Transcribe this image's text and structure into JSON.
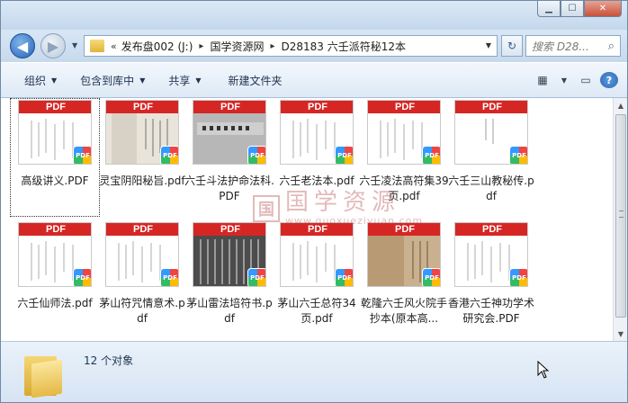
{
  "window": {
    "controls": {
      "minimize": "▁",
      "maximize": "☐",
      "close": "✕"
    }
  },
  "nav": {
    "back_glyph": "◀",
    "forward_glyph": "▶",
    "address": {
      "chevron": "«",
      "crumbs": [
        "发布盘002 (J:)",
        "国学资源网",
        "D28183 六壬派符秘12本"
      ],
      "separator": "▸"
    },
    "refresh_glyph": "↻",
    "search": {
      "placeholder": "搜索 D28...",
      "icon": "search-icon"
    }
  },
  "toolbar": {
    "organize": "组织",
    "include_in_library": "包含到库中",
    "share": "共享",
    "new_folder": "新建文件夹",
    "view_glyph": "▦",
    "pane_glyph": "▭",
    "help_glyph": "?"
  },
  "files": [
    {
      "name": "高级讲义.PDF",
      "thumb": "PDF",
      "art": "lines",
      "selected": true
    },
    {
      "name": "灵宝阴阳秘旨.pdf",
      "thumb": "PDF",
      "art": "scan"
    },
    {
      "name": "六壬斗法护命法科.PDF",
      "thumb": "PDF",
      "art": "gray-title"
    },
    {
      "name": "六壬老法本.pdf",
      "thumb": "PDF",
      "art": "lines"
    },
    {
      "name": "六壬凌法高符集39页.pdf",
      "thumb": "PDF",
      "art": "lines"
    },
    {
      "name": "六壬三山教秘传.pdf",
      "thumb": "PDF",
      "art": "cols"
    },
    {
      "name": "六壬仙师法.pdf",
      "thumb": "PDF",
      "art": "lines"
    },
    {
      "name": "茅山符咒情意术.pdf",
      "thumb": "PDF",
      "art": "lines"
    },
    {
      "name": "茅山雷法培符书.pdf",
      "thumb": "PDF",
      "art": "dark"
    },
    {
      "name": "茅山六壬总符34页.pdf",
      "thumb": "PDF",
      "art": "lines"
    },
    {
      "name": "乾隆六壬风火院手抄本(原本高...",
      "thumb": "PDF",
      "art": "aged"
    },
    {
      "name": "香港六壬神功学术研究会.PDF",
      "thumb": "PDF",
      "art": "lines"
    }
  ],
  "badge_label": "PDF",
  "watermark": {
    "seal": "国",
    "text": "国学资源",
    "url": "www.guoxueziyuan.com"
  },
  "status": {
    "count": "12 个对象"
  }
}
